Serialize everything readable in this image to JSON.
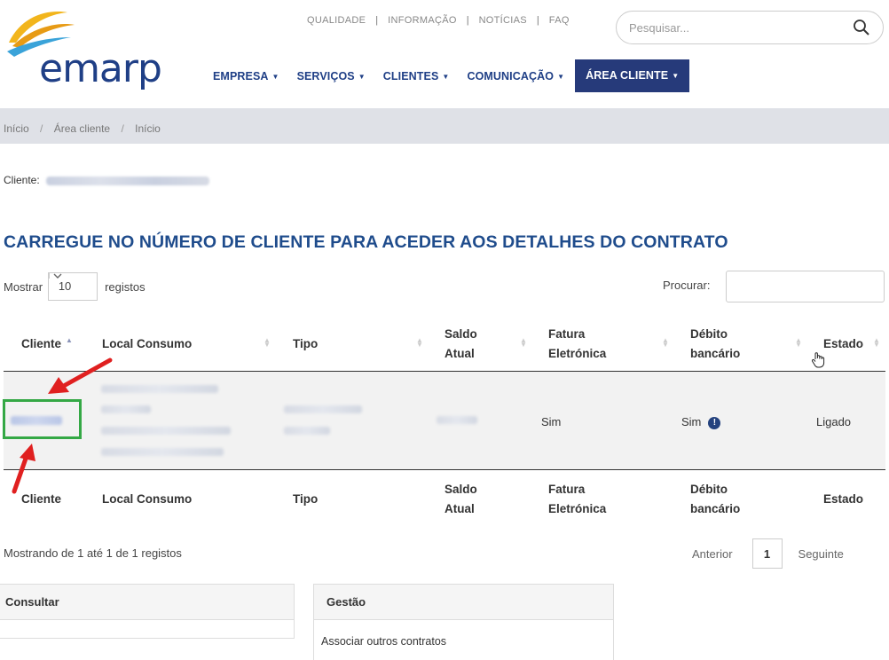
{
  "header": {
    "logo_text": "emarp",
    "top_links": [
      "QUALIDADE",
      "INFORMAÇÃO",
      "NOTÍCIAS",
      "FAQ"
    ],
    "search_placeholder": "Pesquisar...",
    "nav": [
      {
        "label": "EMPRESA"
      },
      {
        "label": "SERVIÇOS"
      },
      {
        "label": "CLIENTES"
      },
      {
        "label": "COMUNICAÇÃO"
      },
      {
        "label": "ÁREA CLIENTE",
        "active": true
      }
    ]
  },
  "breadcrumb": [
    "Início",
    "Área cliente",
    "Início"
  ],
  "client": {
    "label": "Cliente:"
  },
  "heading": "CARREGUE NO NÚMERO DE CLIENTE PARA ACEDER AOS DETALHES DO CONTRATO",
  "controls": {
    "show_label": "Mostrar",
    "show_value": "10",
    "show_suffix": "registos",
    "search_label": "Procurar:"
  },
  "table": {
    "columns": {
      "cliente": "Cliente",
      "local": "Local Consumo",
      "tipo": "Tipo",
      "saldo_1": "Saldo",
      "saldo_2": "Atual",
      "fatura_1": "Fatura",
      "fatura_2": "Eletrónica",
      "debito_1": "Débito",
      "debito_2": "bancário",
      "estado": "Estado"
    },
    "row": {
      "fatura": "Sim",
      "debito": "Sim",
      "estado": "Ligado"
    }
  },
  "footer": {
    "showing": "Mostrando de 1 até 1 de 1 registos",
    "prev": "Anterior",
    "page": "1",
    "next": "Seguinte"
  },
  "panels": {
    "consultar": "Consultar",
    "gestao": "Gestão",
    "gestao_item": "Associar outros contratos"
  },
  "colors": {
    "brand_blue": "#1f3f86",
    "nav_active_bg": "#263a7a",
    "highlight_green": "#34a845",
    "arrow_red": "#e02020"
  }
}
